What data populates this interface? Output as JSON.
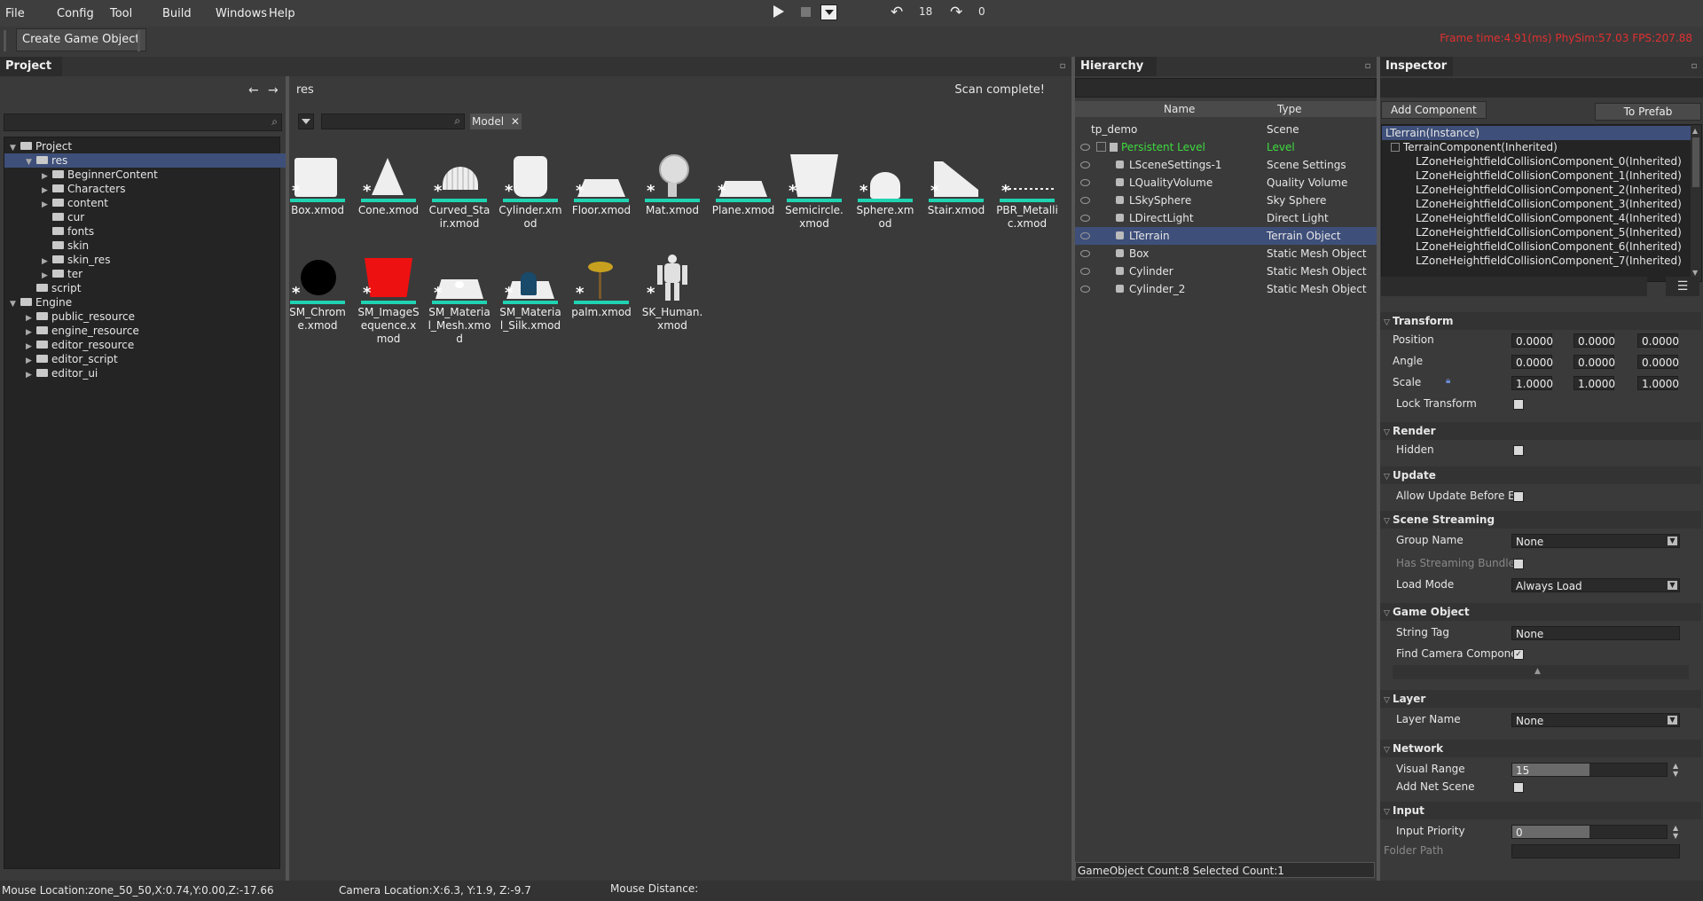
{
  "menu": [
    "File",
    "Config",
    "Tool",
    "Build",
    "Windows",
    "Help"
  ],
  "toolbar": {
    "create_game_object": "Create Game Object",
    "undo_count": "18",
    "redo_count": "0"
  },
  "stats": "Frame time:4.91(ms)   PhySim:57.03   FPS:207.88",
  "project": {
    "title": "Project",
    "tree": [
      {
        "label": "Project",
        "depth": 0,
        "expanded": true
      },
      {
        "label": "res",
        "depth": 1,
        "expanded": true,
        "selected": true
      },
      {
        "label": "BeginnerContent",
        "depth": 2,
        "has_children": true
      },
      {
        "label": "Characters",
        "depth": 2,
        "has_children": true
      },
      {
        "label": "content",
        "depth": 2,
        "has_children": true
      },
      {
        "label": "cur",
        "depth": 2
      },
      {
        "label": "fonts",
        "depth": 2
      },
      {
        "label": "skin",
        "depth": 2
      },
      {
        "label": "skin_res",
        "depth": 2,
        "has_children": true
      },
      {
        "label": "ter",
        "depth": 2,
        "has_children": true
      },
      {
        "label": "script",
        "depth": 1
      },
      {
        "label": "Engine",
        "depth": 0,
        "expanded": true
      },
      {
        "label": "public_resource",
        "depth": 1,
        "has_children": true
      },
      {
        "label": "engine_resource",
        "depth": 1,
        "has_children": true
      },
      {
        "label": "editor_resource",
        "depth": 1,
        "has_children": true
      },
      {
        "label": "editor_script",
        "depth": 1,
        "has_children": true
      },
      {
        "label": "editor_ui",
        "depth": 1,
        "has_children": true
      }
    ]
  },
  "browser": {
    "path": "res",
    "status": "Scan complete!",
    "filter_tag": "Model",
    "assets": [
      {
        "name": "Box.xmod",
        "icon": "box-thumb"
      },
      {
        "name": "Cone.xmod",
        "icon": "cone-thumb"
      },
      {
        "name": "Curved_Stair.xmod",
        "icon": "curved-stair-thumb"
      },
      {
        "name": "Cylinder.xmod",
        "icon": "cylinder-thumb"
      },
      {
        "name": "Floor.xmod",
        "icon": "floor-thumb"
      },
      {
        "name": "Mat.xmod",
        "icon": "mat-thumb"
      },
      {
        "name": "Plane.xmod",
        "icon": "plane-thumb"
      },
      {
        "name": "Semicircle.xmod",
        "icon": "semicircle-thumb"
      },
      {
        "name": "Sphere.xmod",
        "icon": "sphere-thumb"
      },
      {
        "name": "Stair.xmod",
        "icon": "stair-thumb"
      },
      {
        "name": "PBR_Metallic.xmod",
        "icon": "pbr-metallic-thumb"
      },
      {
        "name": "SM_Chrome.xmod",
        "icon": "chrome-thumb"
      },
      {
        "name": "SM_ImageSequence.xmod",
        "icon": "image-sequence-thumb"
      },
      {
        "name": "SM_Material_Mesh.xmod",
        "icon": "material-mesh-thumb"
      },
      {
        "name": "SM_Material_Silk.xmod",
        "icon": "material-silk-thumb"
      },
      {
        "name": "palm.xmod",
        "icon": "palm-thumb"
      },
      {
        "name": "SK_Human.xmod",
        "icon": "human-thumb"
      }
    ]
  },
  "hierarchy": {
    "title": "Hierarchy",
    "col_name": "Name",
    "col_type": "Type",
    "rows": [
      {
        "name": "tp_demo",
        "type": "Scene",
        "level": 0
      },
      {
        "name": "Persistent Level",
        "type": "Level",
        "level": 1
      },
      {
        "name": "LSceneSettings-1",
        "type": "Scene Settings",
        "level": 2
      },
      {
        "name": "LQualityVolume",
        "type": "Quality Volume",
        "level": 2
      },
      {
        "name": "LSkySphere",
        "type": "Sky Sphere",
        "level": 2
      },
      {
        "name": "LDirectLight",
        "type": "Direct Light",
        "level": 2
      },
      {
        "name": "LTerrain",
        "type": "Terrain Object",
        "level": 2,
        "selected": true
      },
      {
        "name": "Box",
        "type": "Static Mesh Object",
        "level": 2
      },
      {
        "name": "Cylinder",
        "type": "Static Mesh Object",
        "level": 2
      },
      {
        "name": "Cylinder_2",
        "type": "Static Mesh Object",
        "level": 2
      }
    ],
    "footer": "GameObject Count:8     Selected Count:1",
    "level_color": "#3ddc3d"
  },
  "inspector": {
    "title": "Inspector",
    "add_component": "Add Component",
    "to_prefab": "To Prefab",
    "components": [
      "LTerrain(Instance)",
      "TerrainComponent(Inherited)",
      "LZoneHeightfieldCollisionComponent_0(Inherited)",
      "LZoneHeightfieldCollisionComponent_1(Inherited)",
      "LZoneHeightfieldCollisionComponent_2(Inherited)",
      "LZoneHeightfieldCollisionComponent_3(Inherited)",
      "LZoneHeightfieldCollisionComponent_4(Inherited)",
      "LZoneHeightfieldCollisionComponent_5(Inherited)",
      "LZoneHeightfieldCollisionComponent_6(Inherited)",
      "LZoneHeightfieldCollisionComponent_7(Inherited)"
    ],
    "transform": {
      "title": "Transform",
      "position_label": "Position",
      "position": [
        "0.0000",
        "0.0000",
        "0.0000"
      ],
      "angle_label": "Angle",
      "angle": [
        "0.0000",
        "0.0000",
        "0.0000"
      ],
      "scale_label": "Scale",
      "scale": [
        "1.0000",
        "1.0000",
        "1.0000"
      ],
      "lock_label": "Lock Transform"
    },
    "render": {
      "title": "Render",
      "hidden_label": "Hidden"
    },
    "update": {
      "title": "Update",
      "allow_label": "Allow Update Before E"
    },
    "streaming": {
      "title": "Scene Streaming",
      "group_label": "Group Name",
      "group_value": "None",
      "bundle_label": "Has Streaming Bundle",
      "load_label": "Load Mode",
      "load_value": "Always Load"
    },
    "game_object": {
      "title": "Game Object",
      "tag_label": "String Tag",
      "tag_value": "None",
      "camera_label": "Find Camera Compone"
    },
    "layer": {
      "title": "Layer",
      "name_label": "Layer Name",
      "name_value": "None"
    },
    "network": {
      "title": "Network",
      "range_label": "Visual Range",
      "range_value": "15",
      "net_label": "Add Net Scene"
    },
    "input": {
      "title": "Input",
      "priority_label": "Input Priority",
      "priority_value": "0",
      "folder_label": "Folder Path"
    }
  },
  "status": {
    "mouse": "Mouse Location:zone_50_50,X:0.74,Y:0.00,Z:-17.66",
    "camera": "Camera Location:X:6.3, Y:1.9, Z:-9.7",
    "distance": "Mouse Distance:"
  }
}
